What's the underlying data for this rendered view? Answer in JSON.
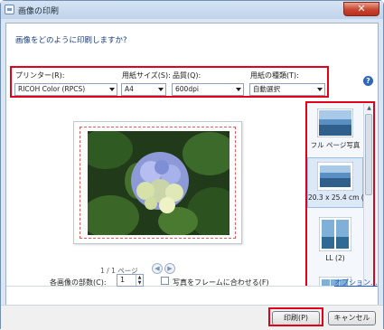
{
  "window": {
    "title": "画像の印刷",
    "close_glyph": "✕"
  },
  "header": {
    "question": "画像をどのように印刷しますか?",
    "help_glyph": "?"
  },
  "settings": {
    "printer": {
      "label": "プリンター(R):",
      "value": "RICOH Color (RPCS)"
    },
    "paper_size": {
      "label": "用紙サイズ(S):",
      "value": "A4"
    },
    "quality": {
      "label": "品質(Q):",
      "value": "600dpi"
    },
    "paper_type": {
      "label": "用紙の種類(T):",
      "value": "自動選択"
    }
  },
  "preview": {
    "page_indicator": "1 / 1 ページ",
    "prev_glyph": "◀",
    "next_glyph": "▶"
  },
  "layouts": {
    "items": [
      {
        "label": "フル ページ写真",
        "icon": "landscape-full-page-icon"
      },
      {
        "label": "20.3 x 25.4 cm (1)",
        "icon": "landscape-single-icon"
      },
      {
        "label": "LL (2)",
        "icon": "landscape-two-up-icon"
      },
      {
        "label": "",
        "icon": "landscape-multi-icon"
      }
    ],
    "selected_index": 1,
    "scroll_up": "▲",
    "scroll_down": "▼"
  },
  "bottom": {
    "copies_label": "各画像の部数(C):",
    "copies_value": "1",
    "fit_label": "写真をフレームに合わせる(F)",
    "fit_checked": false,
    "options_link": "オプション..."
  },
  "footer": {
    "print_label": "印刷(P)",
    "cancel_label": "キャンセル"
  },
  "colors": {
    "highlight": "#e3001b",
    "link": "#1f56c9",
    "accent": "#2f66b8"
  }
}
